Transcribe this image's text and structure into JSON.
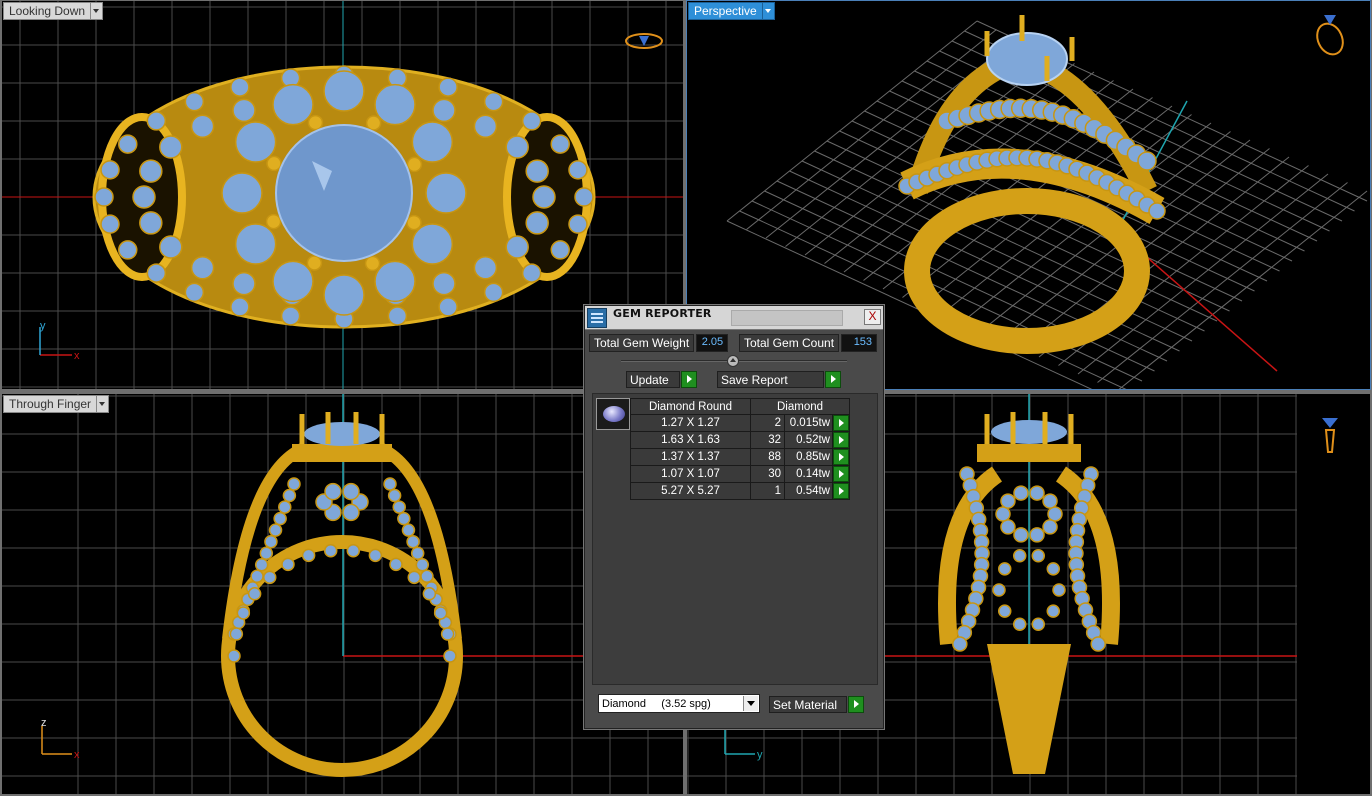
{
  "viewports": {
    "top": {
      "label": "Looking Down",
      "axis_v": "y",
      "axis_h": "x"
    },
    "perspective": {
      "label": "Perspective"
    },
    "front": {
      "label": "Through Finger",
      "axis_v": "z",
      "axis_h": "x"
    },
    "side": {
      "label": "",
      "axis_h": "y"
    }
  },
  "colors": {
    "viewport_bg": "#000000",
    "grid": "#5a5a5a",
    "metal_gold": "#d4a017",
    "gem_blue": "#7fa7d9",
    "axis_red": "#c81414",
    "axis_cyan": "#1fa6b0",
    "active_tab": "#2e8fd8",
    "go_green": "#1f8f1f"
  },
  "gem_reporter": {
    "title": "GEM REPORTER",
    "close_label": "X",
    "total_gem_weight_label": "Total Gem Weight",
    "total_gem_weight": "2.05",
    "total_gem_count_label": "Total Gem Count",
    "total_gem_count": "153",
    "update_label": "Update",
    "save_report_label": "Save Report",
    "table_header_shape": "Diamond Round",
    "table_header_material": "Diamond",
    "rows": [
      {
        "size": "1.27 X 1.27",
        "count": "2",
        "weight": "0.015tw"
      },
      {
        "size": "1.63 X 1.63",
        "count": "32",
        "weight": "0.52tw"
      },
      {
        "size": "1.37 X 1.37",
        "count": "88",
        "weight": "0.85tw"
      },
      {
        "size": "1.07 X 1.07",
        "count": "30",
        "weight": "0.14tw"
      },
      {
        "size": "5.27 X 5.27",
        "count": "1",
        "weight": "0.54tw"
      }
    ],
    "material_value": "Diamond     (3.52 spg)",
    "set_material_label": "Set Material"
  }
}
